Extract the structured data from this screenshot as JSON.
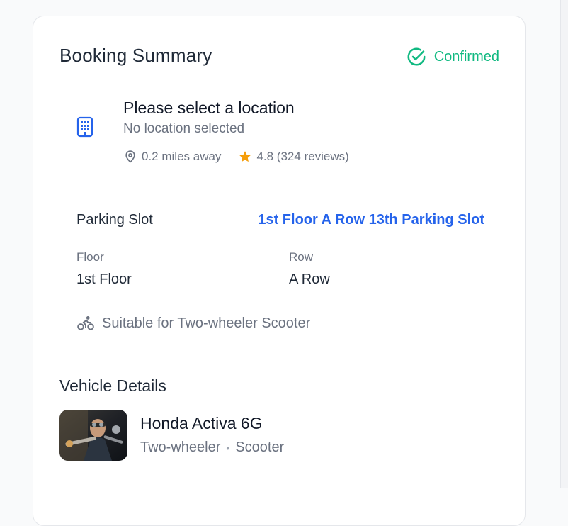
{
  "summary": {
    "title": "Booking Summary",
    "status": "Confirmed",
    "status_color": "#10b981"
  },
  "location": {
    "icon": "building-icon",
    "title": "Please select a location",
    "subtitle": "No location selected",
    "distance": "0.2 miles away",
    "rating": "4.8 (324 reviews)"
  },
  "slot": {
    "label": "Parking Slot",
    "value": "1st Floor A Row 13th Parking Slot",
    "floor_label": "Floor",
    "floor_value": "1st Floor",
    "row_label": "Row",
    "row_value": "A Row",
    "suitable_text": "Suitable for Two-wheeler Scooter"
  },
  "vehicle": {
    "heading": "Vehicle Details",
    "name": "Honda Activa 6G",
    "type": "Two-wheeler",
    "subtype": "Scooter"
  },
  "colors": {
    "accent": "#2563eb",
    "success": "#10b981",
    "star": "#f59e0b"
  }
}
